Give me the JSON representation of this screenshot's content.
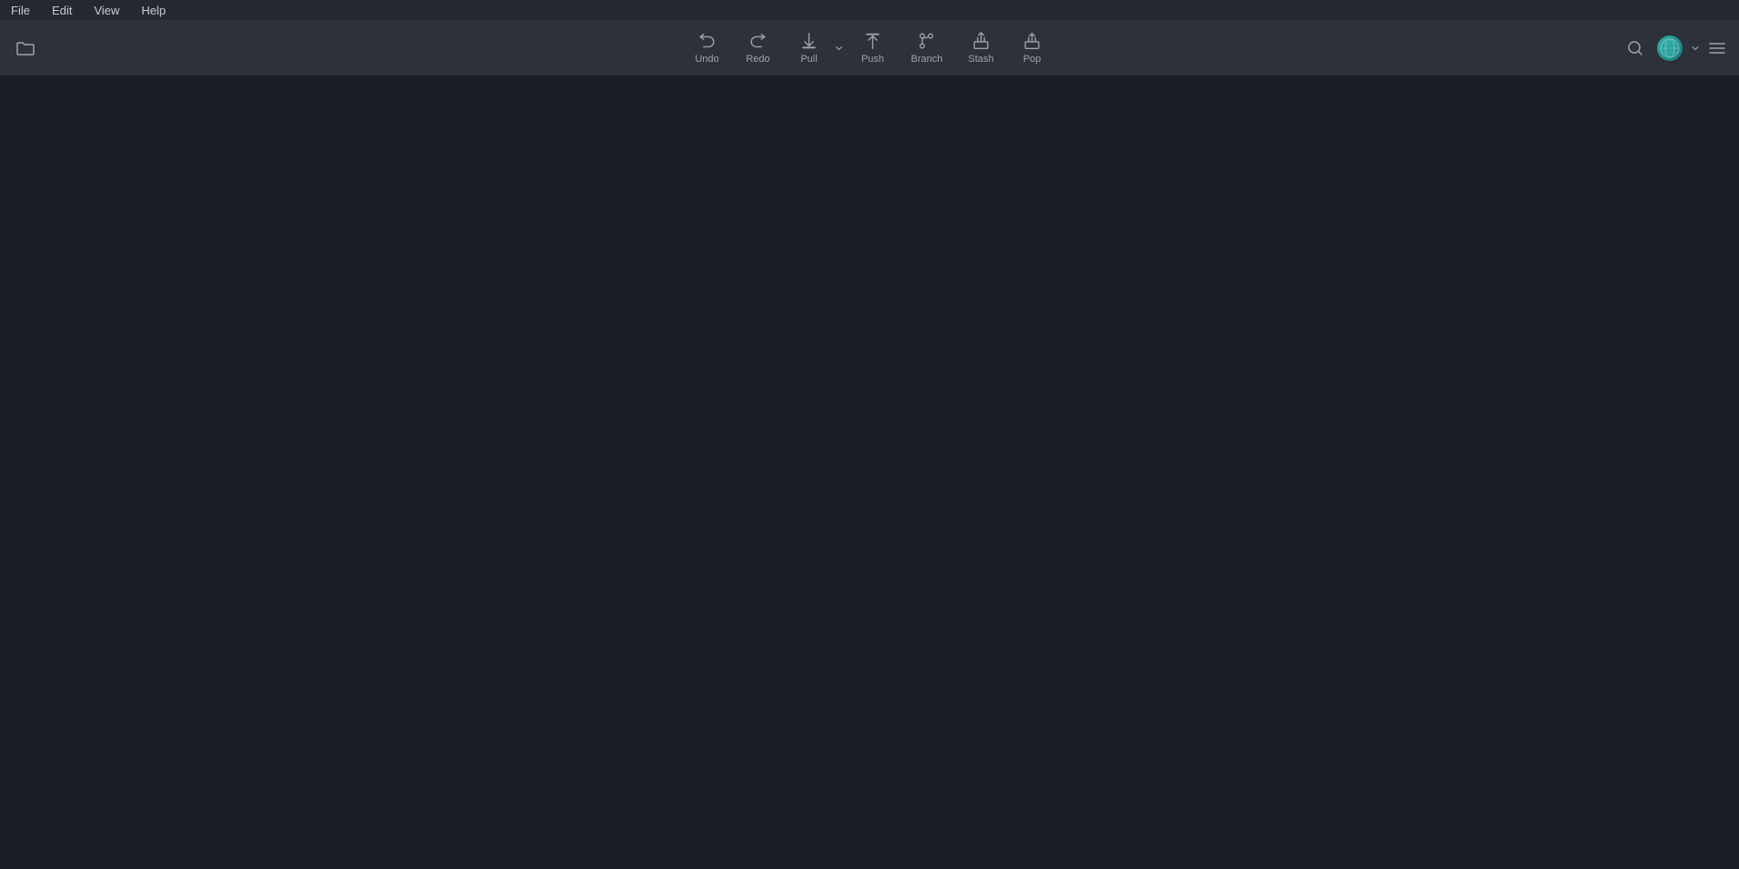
{
  "menubar": {
    "items": [
      {
        "label": "File",
        "name": "file"
      },
      {
        "label": "Edit",
        "name": "edit"
      },
      {
        "label": "View",
        "name": "view"
      },
      {
        "label": "Help",
        "name": "help"
      }
    ]
  },
  "toolbar": {
    "buttons": [
      {
        "name": "undo",
        "label": "Undo",
        "icon": "undo-icon"
      },
      {
        "name": "redo",
        "label": "Redo",
        "icon": "redo-icon"
      },
      {
        "name": "pull",
        "label": "Pull",
        "icon": "pull-icon",
        "has_arrow": true
      },
      {
        "name": "push",
        "label": "Push",
        "icon": "push-icon"
      },
      {
        "name": "branch",
        "label": "Branch",
        "icon": "branch-icon"
      },
      {
        "name": "stash",
        "label": "Stash",
        "icon": "stash-icon"
      },
      {
        "name": "pop",
        "label": "Pop",
        "icon": "pop-icon"
      }
    ]
  },
  "colors": {
    "bg_toolbar": "#2d3139",
    "bg_main": "#1a1d23",
    "bg_menubar": "#252830",
    "text_muted": "#9da3ae",
    "accent": "#2eaca8"
  }
}
